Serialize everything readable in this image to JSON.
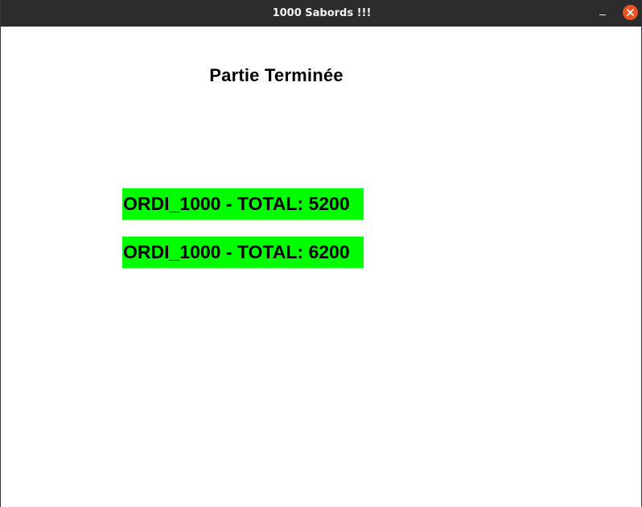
{
  "window": {
    "title": "1000 Sabords !!!",
    "controls": {
      "minimize_icon": "minimize-icon",
      "close_icon": "close-icon",
      "close_color": "#e95420"
    }
  },
  "game": {
    "status_title": "Partie Terminée",
    "scores": [
      {
        "label": "ORDI_1000 - TOTAL: 5200"
      },
      {
        "label": "ORDI_1000 - TOTAL: 6200"
      }
    ],
    "highlight_color": "#00ff00"
  }
}
